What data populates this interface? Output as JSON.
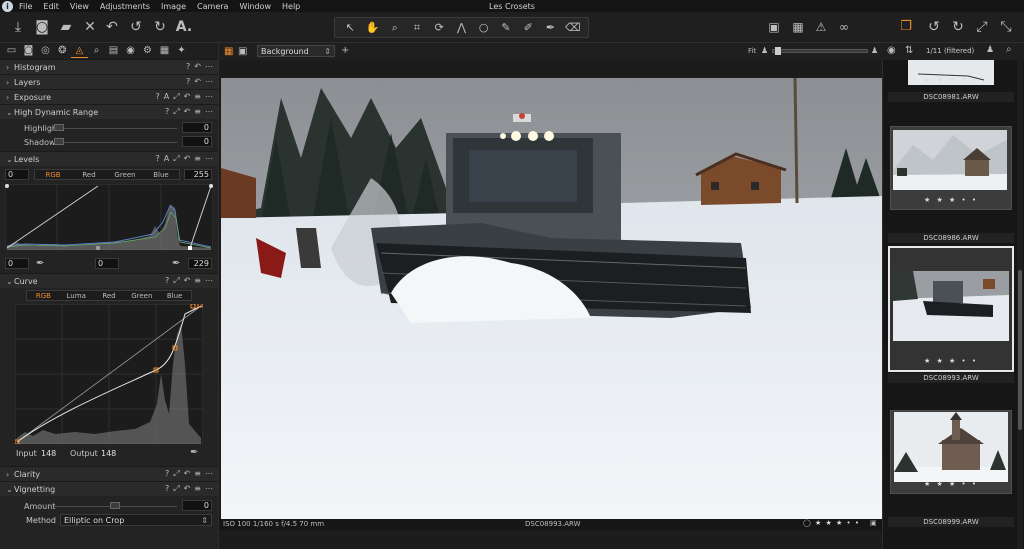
{
  "window": {
    "title": "Les Crosets"
  },
  "menu": [
    "File",
    "Edit",
    "View",
    "Adjustments",
    "Image",
    "Camera",
    "Window",
    "Help"
  ],
  "viewer": {
    "layer_select": "Background",
    "fit_label": "Fit",
    "status_left": "ISO 100 1/160 s f/4.5 70 mm",
    "status_center": "DSC08993.ARW",
    "stars": "★ ★ ★ • •"
  },
  "browser": {
    "count": "1/11 (filtered)",
    "thumbs": [
      {
        "name": "DSC08981.ARW",
        "stars": "★ ★ ★ • •"
      },
      {
        "name": "DSC08986.ARW",
        "stars": "★ ★ ★ • •"
      },
      {
        "name": "DSC08993.ARW",
        "stars": "★ ★ ★ • •"
      },
      {
        "name": "DSC08999.ARW",
        "stars": "★ ★ ★ • •"
      }
    ]
  },
  "tools": {
    "histogram": "Histogram",
    "layers": "Layers",
    "exposure": "Exposure",
    "hdr": {
      "title": "High Dynamic Range",
      "highlight_label": "Highlight",
      "highlight_value": "0",
      "shadow_label": "Shadow",
      "shadow_value": "0"
    },
    "levels": {
      "title": "Levels",
      "channels": [
        "RGB",
        "Red",
        "Green",
        "Blue"
      ],
      "in_low": "0",
      "in_high": "255",
      "out_low": "0",
      "out_mid": "0",
      "out_high": "229"
    },
    "curve": {
      "title": "Curve",
      "channels": [
        "RGB",
        "Luma",
        "Red",
        "Green",
        "Blue"
      ],
      "input_label": "Input",
      "input_value": "148",
      "output_label": "Output",
      "output_value": "148"
    },
    "clarity": "Clarity",
    "vignetting": {
      "title": "Vignetting",
      "amount_label": "Amount",
      "amount_value": "0",
      "method_label": "Method",
      "method_value": "Elliptic on Crop"
    }
  },
  "colors": {
    "accent": "#f08c2e",
    "panel": "#232323",
    "header": "#2a2a2a"
  }
}
